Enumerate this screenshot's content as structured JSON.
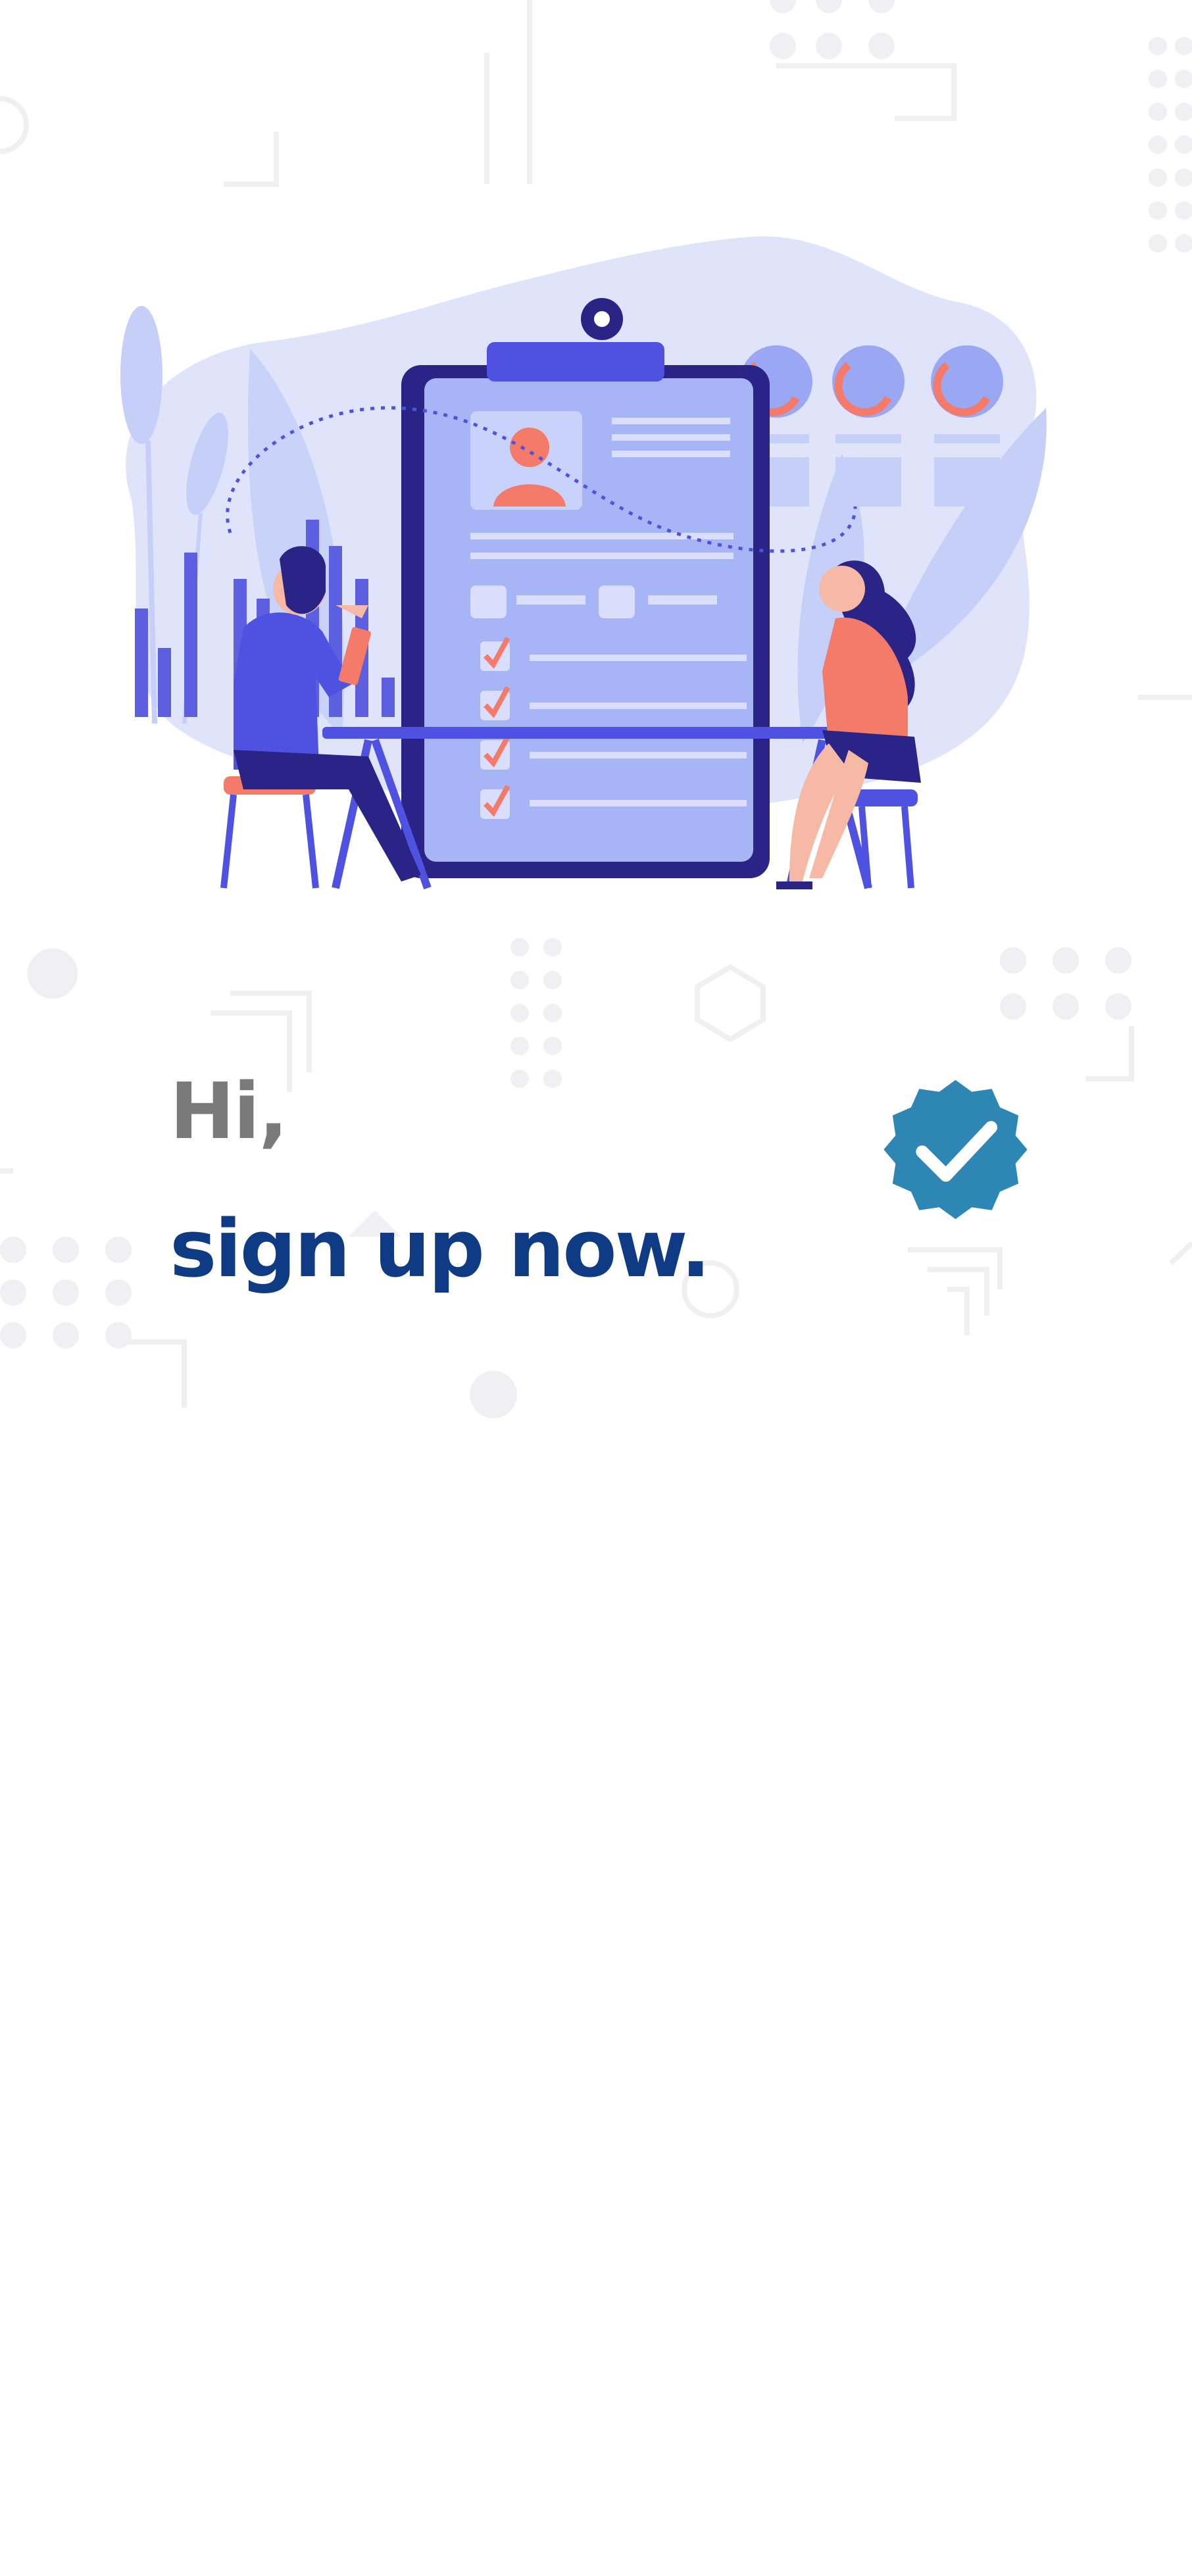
{
  "screen": {
    "greeting": "Hi,",
    "headline": "sign up now."
  },
  "illustration": {
    "name": "job-interview-illustration",
    "icon": "clipboard-resume-illustration"
  },
  "badge": {
    "icon": "verified-check-icon",
    "color": "#2e86b5"
  },
  "colors": {
    "greeting": "#7a7a7a",
    "headline": "#0f3b84",
    "illustration_primary": "#4f52e0",
    "illustration_accent": "#f47a6a",
    "background": "#ffffff"
  }
}
